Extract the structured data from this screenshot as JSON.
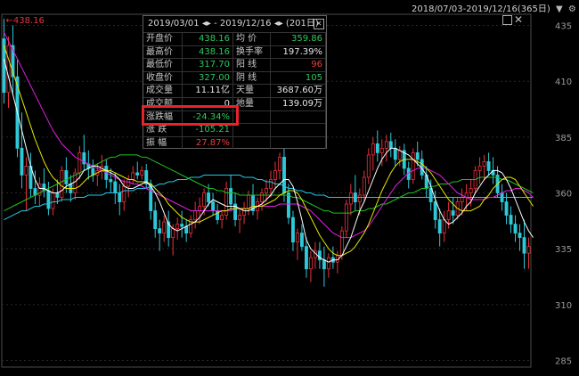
{
  "topbar": {
    "range": "2018/07/03-2019/12/16(365日)",
    "icon_1": "dropdown-triangle-icon",
    "icon_2": "settings-gear-icon"
  },
  "panel": {
    "header_range": "2019/03/01",
    "header_arrows": "◂▸",
    "header_sep": " - ",
    "header_end": "2019/12/16",
    "header_arrows2": "◂▸",
    "header_days": "(201日)",
    "rows": [
      {
        "l1": "开盘价",
        "v1": "438.16",
        "c1": "green",
        "l2": "均 价",
        "v2": "359.86",
        "c2": "green"
      },
      {
        "l1": "最高价",
        "v1": "438.16",
        "c1": "green",
        "l2": "换手率",
        "v2": "197.39%",
        "c2": "white"
      },
      {
        "l1": "最低价",
        "v1": "317.70",
        "c1": "green",
        "l2": "阳 线",
        "v2": "96",
        "c2": "red"
      },
      {
        "l1": "收盘价",
        "v1": "327.00",
        "c1": "green",
        "l2": "阴 线",
        "v2": "105",
        "c2": "green"
      },
      {
        "l1": "成交量",
        "v1": "11.11亿",
        "c1": "white",
        "l2": "天量",
        "v2": "3687.60万",
        "c2": "white"
      },
      {
        "l1": "成交额",
        "v1": "0",
        "c1": "white",
        "l2": "地量",
        "v2": "139.09万",
        "c2": "white"
      },
      {
        "l1": "涨跌幅",
        "v1": "-24.34%",
        "c1": "green",
        "l2": "",
        "v2": "",
        "c2": "white"
      },
      {
        "l1": "涨 跌",
        "v1": "-105.21",
        "c1": "green",
        "l2": "",
        "v2": "",
        "c2": "white"
      },
      {
        "l1": "振 幅",
        "v1": "27.87%",
        "c1": "red",
        "l2": "",
        "v2": "",
        "c2": "white"
      }
    ]
  },
  "chart_data": {
    "type": "line",
    "title": "",
    "xlabel": "",
    "ylabel": "",
    "ylim": [
      282,
      440
    ],
    "yticks": [
      435,
      410,
      385,
      360,
      335,
      310,
      285
    ],
    "high_marker": "438.16",
    "grid": true,
    "colors": {
      "up": "#e8323c",
      "down": "#2ec8d8",
      "ma5": "#ffffff",
      "ma10": "#e6e600",
      "ma20": "#e020e0",
      "ma60": "#20c020",
      "ma120": "#20c8e6"
    },
    "candles": [
      [
        429,
        438,
        400,
        405
      ],
      [
        405,
        430,
        398,
        426
      ],
      [
        426,
        435,
        404,
        412
      ],
      [
        412,
        420,
        376,
        380
      ],
      [
        380,
        396,
        362,
        368
      ],
      [
        368,
        376,
        352,
        372
      ],
      [
        372,
        378,
        358,
        362
      ],
      [
        362,
        370,
        355,
        359
      ],
      [
        359,
        367,
        354,
        364
      ],
      [
        364,
        371,
        358,
        361
      ],
      [
        361,
        365,
        350,
        353
      ],
      [
        353,
        362,
        350,
        360
      ],
      [
        360,
        366,
        355,
        358
      ],
      [
        358,
        372,
        356,
        370
      ],
      [
        370,
        376,
        360,
        364
      ],
      [
        364,
        368,
        356,
        360
      ],
      [
        360,
        371,
        357,
        369
      ],
      [
        369,
        381,
        366,
        378
      ],
      [
        378,
        386,
        370,
        373
      ],
      [
        373,
        379,
        366,
        371
      ],
      [
        371,
        375,
        365,
        368
      ],
      [
        368,
        373,
        363,
        370
      ],
      [
        370,
        377,
        366,
        372
      ],
      [
        372,
        375,
        362,
        366
      ],
      [
        366,
        371,
        360,
        365
      ],
      [
        365,
        369,
        355,
        360
      ],
      [
        360,
        364,
        350,
        356
      ],
      [
        356,
        366,
        352,
        363
      ],
      [
        363,
        368,
        358,
        366
      ],
      [
        366,
        372,
        364,
        369
      ],
      [
        369,
        374,
        366,
        368
      ],
      [
        368,
        372,
        366,
        370
      ],
      [
        370,
        373,
        362,
        364
      ],
      [
        364,
        366,
        348,
        352
      ],
      [
        352,
        356,
        340,
        344
      ],
      [
        344,
        348,
        334,
        342
      ],
      [
        342,
        350,
        338,
        347
      ],
      [
        347,
        352,
        336,
        340
      ],
      [
        340,
        346,
        332,
        344
      ],
      [
        344,
        349,
        339,
        346
      ],
      [
        346,
        352,
        340,
        345
      ],
      [
        345,
        348,
        338,
        342
      ],
      [
        342,
        350,
        340,
        348
      ],
      [
        348,
        356,
        344,
        352
      ],
      [
        352,
        358,
        346,
        354
      ],
      [
        354,
        362,
        350,
        360
      ],
      [
        360,
        364,
        354,
        356
      ],
      [
        356,
        360,
        350,
        352
      ],
      [
        352,
        355,
        346,
        348
      ],
      [
        348,
        352,
        344,
        350
      ],
      [
        350,
        365,
        348,
        362
      ],
      [
        362,
        368,
        352,
        355
      ],
      [
        355,
        360,
        345,
        348
      ],
      [
        348,
        353,
        342,
        350
      ],
      [
        350,
        356,
        346,
        353
      ],
      [
        353,
        361,
        350,
        359
      ],
      [
        359,
        364,
        350,
        352
      ],
      [
        352,
        358,
        348,
        356
      ],
      [
        356,
        362,
        352,
        360
      ],
      [
        360,
        366,
        356,
        362
      ],
      [
        362,
        370,
        358,
        366
      ],
      [
        366,
        374,
        362,
        370
      ],
      [
        370,
        378,
        366,
        376
      ],
      [
        376,
        380,
        356,
        360
      ],
      [
        360,
        364,
        346,
        349
      ],
      [
        349,
        352,
        334,
        338
      ],
      [
        338,
        344,
        330,
        342
      ],
      [
        342,
        346,
        334,
        336
      ],
      [
        336,
        340,
        322,
        326
      ],
      [
        326,
        334,
        320,
        331
      ],
      [
        331,
        338,
        326,
        334
      ],
      [
        334,
        338,
        326,
        330
      ],
      [
        330,
        336,
        318,
        326
      ],
      [
        326,
        333,
        322,
        331
      ],
      [
        331,
        336,
        326,
        329
      ],
      [
        329,
        334,
        324,
        332
      ],
      [
        332,
        345,
        330,
        343
      ],
      [
        343,
        357,
        340,
        355
      ],
      [
        355,
        364,
        350,
        360
      ],
      [
        360,
        368,
        352,
        356
      ],
      [
        356,
        362,
        350,
        359
      ],
      [
        359,
        370,
        356,
        367
      ],
      [
        367,
        380,
        364,
        377
      ],
      [
        377,
        385,
        370,
        382
      ],
      [
        382,
        388,
        374,
        378
      ],
      [
        378,
        384,
        372,
        380
      ],
      [
        380,
        386,
        374,
        383
      ],
      [
        383,
        387,
        376,
        380
      ],
      [
        380,
        384,
        372,
        375
      ],
      [
        375,
        381,
        372,
        379
      ],
      [
        379,
        382,
        368,
        371
      ],
      [
        371,
        374,
        362,
        366
      ],
      [
        366,
        380,
        364,
        378
      ],
      [
        378,
        383,
        372,
        375
      ],
      [
        375,
        379,
        366,
        368
      ],
      [
        368,
        372,
        358,
        362
      ],
      [
        362,
        366,
        352,
        356
      ],
      [
        356,
        361,
        344,
        348
      ],
      [
        348,
        353,
        336,
        342
      ],
      [
        342,
        352,
        338,
        348
      ],
      [
        348,
        356,
        344,
        352
      ],
      [
        352,
        358,
        346,
        350
      ],
      [
        350,
        358,
        348,
        356
      ],
      [
        356,
        362,
        350,
        358
      ],
      [
        358,
        364,
        352,
        360
      ],
      [
        360,
        366,
        354,
        362
      ],
      [
        362,
        372,
        360,
        370
      ],
      [
        370,
        376,
        364,
        372
      ],
      [
        372,
        377,
        366,
        374
      ],
      [
        374,
        378,
        368,
        370
      ],
      [
        370,
        376,
        364,
        368
      ],
      [
        368,
        372,
        358,
        360
      ],
      [
        360,
        364,
        352,
        356
      ],
      [
        356,
        360,
        346,
        350
      ],
      [
        350,
        354,
        342,
        346
      ],
      [
        346,
        350,
        338,
        342
      ],
      [
        342,
        346,
        334,
        340
      ],
      [
        340,
        348,
        326,
        333
      ],
      [
        333,
        340,
        326,
        336
      ]
    ],
    "ma5": [
      420,
      412,
      404,
      396,
      388,
      380,
      372,
      366,
      362,
      362,
      361,
      360,
      360,
      361,
      363,
      364,
      365,
      367,
      370,
      371,
      372,
      372,
      371,
      370,
      369,
      368,
      366,
      363,
      362,
      362,
      363,
      364,
      365,
      363,
      360,
      356,
      351,
      346,
      344,
      343,
      344,
      345,
      346,
      347,
      349,
      352,
      355,
      357,
      356,
      355,
      354,
      354,
      354,
      353,
      352,
      352,
      353,
      354,
      355,
      357,
      359,
      362,
      364,
      366,
      366,
      363,
      356,
      348,
      339,
      335,
      333,
      331,
      330,
      329,
      330,
      330,
      332,
      336,
      340,
      346,
      352,
      356,
      361,
      366,
      371,
      375,
      378,
      380,
      380,
      379,
      378,
      377,
      375,
      373,
      371,
      368,
      363,
      357,
      352,
      348,
      346,
      347,
      349,
      351,
      354,
      356,
      360,
      363,
      366,
      368,
      370,
      370,
      369,
      366,
      362,
      357,
      352,
      347,
      343,
      340
    ],
    "ma10": [
      426,
      420,
      414,
      408,
      402,
      396,
      390,
      384,
      379,
      374,
      370,
      367,
      365,
      363,
      362,
      362,
      362,
      363,
      365,
      367,
      368,
      369,
      370,
      370,
      370,
      369,
      368,
      367,
      366,
      366,
      365,
      365,
      365,
      364,
      362,
      360,
      358,
      355,
      353,
      351,
      349,
      348,
      347,
      347,
      347,
      348,
      349,
      350,
      351,
      352,
      352,
      353,
      353,
      353,
      353,
      353,
      354,
      354,
      354,
      355,
      356,
      357,
      359,
      360,
      361,
      361,
      360,
      357,
      353,
      349,
      345,
      341,
      338,
      335,
      333,
      332,
      332,
      333,
      334,
      336,
      339,
      342,
      346,
      351,
      356,
      361,
      365,
      369,
      372,
      374,
      375,
      375,
      375,
      374,
      373,
      371,
      369,
      366,
      363,
      360,
      357,
      355,
      353,
      352,
      352,
      352,
      353,
      354,
      357,
      359,
      362,
      364,
      366,
      367,
      367,
      366,
      363,
      360,
      357,
      354
    ],
    "ma20": [
      432,
      428,
      424,
      420,
      416,
      412,
      408,
      404,
      400,
      396,
      392,
      388,
      385,
      382,
      380,
      378,
      376,
      375,
      374,
      373,
      372,
      371,
      370,
      369,
      368,
      367,
      366,
      365,
      365,
      364,
      364,
      363,
      362,
      361,
      360,
      359,
      358,
      357,
      356,
      355,
      354,
      353,
      352,
      352,
      352,
      352,
      352,
      352,
      352,
      352,
      352,
      352,
      353,
      353,
      353,
      353,
      354,
      354,
      354,
      354,
      354,
      354,
      355,
      355,
      355,
      355,
      355,
      354,
      353,
      352,
      350,
      348,
      346,
      344,
      342,
      341,
      340,
      340,
      340,
      341,
      342,
      343,
      345,
      348,
      351,
      354,
      357,
      360,
      363,
      365,
      367,
      369,
      370,
      371,
      371,
      371,
      370,
      369,
      368,
      366,
      364,
      362,
      360,
      359,
      358,
      357,
      357,
      357,
      357,
      358,
      358,
      359,
      360,
      361,
      361,
      362,
      362,
      361,
      360,
      358
    ],
    "ma60": [
      352,
      353,
      354,
      355,
      356,
      357,
      358,
      359,
      360,
      361,
      362,
      363,
      364,
      365,
      366,
      367,
      368,
      369,
      370,
      371,
      372,
      373,
      374,
      375,
      376,
      376,
      377,
      377,
      377,
      377,
      377,
      376,
      376,
      375,
      374,
      373,
      372,
      371,
      370,
      369,
      368,
      367,
      366,
      365,
      364,
      363,
      362,
      362,
      361,
      361,
      360,
      360,
      360,
      359,
      359,
      359,
      359,
      359,
      359,
      359,
      359,
      359,
      359,
      359,
      359,
      358,
      358,
      357,
      356,
      355,
      354,
      353,
      352,
      352,
      351,
      351,
      351,
      351,
      351,
      352,
      352,
      352,
      353,
      353,
      354,
      355,
      355,
      356,
      357,
      358,
      359,
      360,
      360,
      361,
      362,
      362,
      363,
      363,
      364,
      364,
      364,
      365,
      365,
      366,
      366,
      366,
      366,
      367,
      367,
      367,
      367,
      367,
      366,
      366,
      365,
      364,
      363,
      362,
      361,
      360
    ],
    "ma120": [
      348,
      349,
      350,
      351,
      352,
      352,
      353,
      354,
      354,
      355,
      355,
      356,
      356,
      357,
      357,
      357,
      358,
      358,
      358,
      359,
      359,
      359,
      359,
      360,
      360,
      360,
      360,
      361,
      361,
      361,
      362,
      362,
      362,
      363,
      363,
      364,
      364,
      365,
      365,
      366,
      366,
      366,
      367,
      367,
      367,
      368,
      368,
      368,
      368,
      368,
      368,
      368,
      368,
      368,
      367,
      367,
      367,
      366,
      366,
      365,
      365,
      364,
      364,
      363,
      362,
      362,
      361,
      361,
      360,
      360,
      359,
      359,
      359,
      358,
      358,
      358,
      358,
      358,
      358,
      358,
      358,
      358,
      358,
      358,
      358,
      358,
      358,
      358,
      358,
      358,
      358,
      358,
      358,
      358,
      358,
      358,
      358,
      358,
      358,
      358,
      358,
      358,
      358,
      358,
      358,
      358,
      358,
      358,
      358,
      358,
      358,
      358,
      358,
      358,
      358,
      358,
      358,
      358,
      358,
      358
    ]
  }
}
